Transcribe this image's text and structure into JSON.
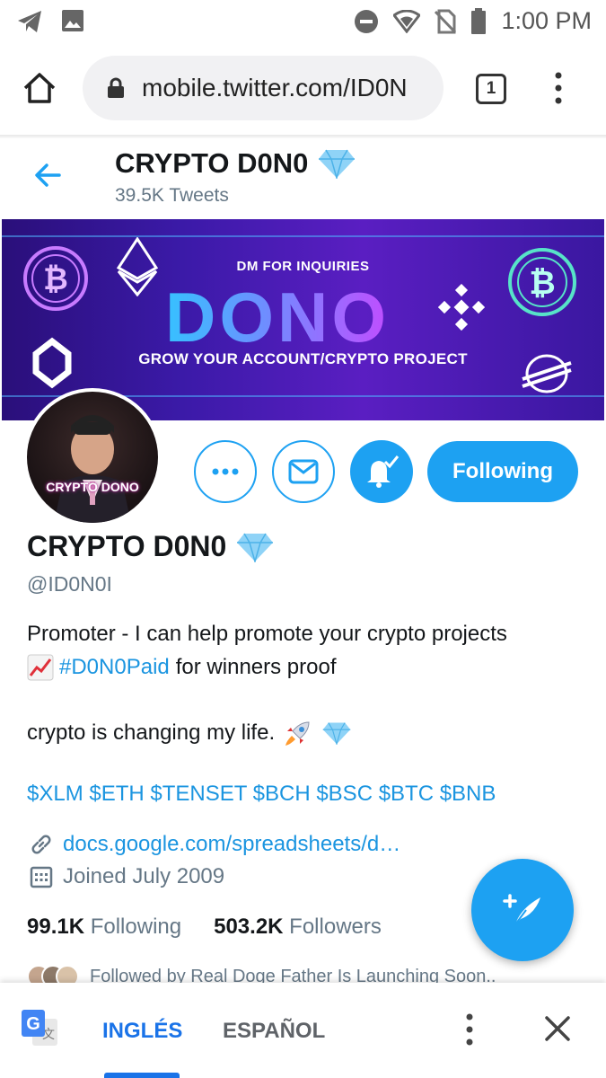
{
  "status_bar": {
    "time": "1:00 PM",
    "icons": [
      "telegram-icon",
      "image-icon",
      "do-not-disturb-icon",
      "wifi-icon",
      "no-sim-icon",
      "battery-icon"
    ]
  },
  "browser": {
    "url": "mobile.twitter.com/ID0N",
    "tab_count": "1",
    "icons": [
      "home-icon",
      "lock-icon",
      "menu-dots-icon"
    ]
  },
  "header": {
    "name": "CRYPTO D0N0",
    "tweets": "39.5K Tweets",
    "badge_icon": "diamond-icon"
  },
  "banner": {
    "top_text": "DM FOR INQUIRIES",
    "title": "DONO",
    "bottom_text": "GROW YOUR ACCOUNT/CRYPTO PROJECT"
  },
  "avatar": {
    "label": "CRYPTO DONO"
  },
  "actions": {
    "following_label": "Following"
  },
  "profile": {
    "name": "CRYPTO D0N0",
    "handle": "@ID0N0I",
    "bio_line1": "Promoter - I can help promote your crypto projects",
    "bio_hashtag": "#D0N0Paid",
    "bio_line2_rest": "for winners proof",
    "bio_line3": "crypto is changing my life.",
    "tickers": "$XLM $ETH $TENSET $BCH $BSC $BTC $BNB",
    "link": "docs.google.com/spreadsheets/d…",
    "joined": "Joined July 2009",
    "following_count": "99.1K",
    "following_label": "Following",
    "followers_count": "503.2K",
    "followers_label": "Followers",
    "followed_by": "Followed by Real Doge Father Is Launching Soon.."
  },
  "translate": {
    "lang_active": "INGLÉS",
    "lang_other": "ESPAÑOL"
  },
  "colors": {
    "twitter_blue": "#1da1f2",
    "link_blue": "#1b95e0",
    "google_blue": "#1a73e8"
  }
}
